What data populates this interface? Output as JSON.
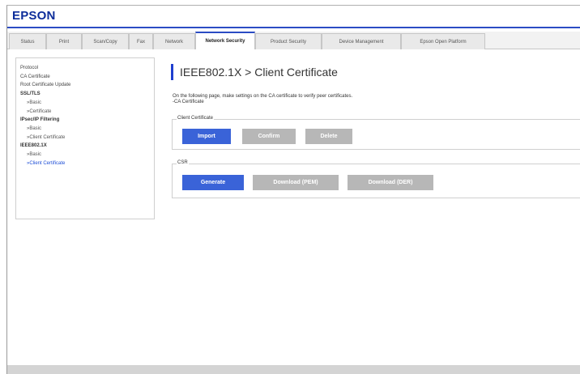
{
  "brand": {
    "logo_text": "EPSON",
    "accent_color": "#2b4cc4"
  },
  "tabs": [
    {
      "label": "Status",
      "active": false
    },
    {
      "label": "Print",
      "active": false
    },
    {
      "label": "Scan/Copy",
      "active": false
    },
    {
      "label": "Fax",
      "active": false
    },
    {
      "label": "Network",
      "active": false
    },
    {
      "label": "Network Security",
      "active": true
    },
    {
      "label": "Product Security",
      "active": false
    },
    {
      "label": "Device Management",
      "active": false
    },
    {
      "label": "Epson Open Platform",
      "active": false
    }
  ],
  "sidebar": {
    "items": [
      {
        "label": "Protocol"
      },
      {
        "label": "CA Certificate"
      },
      {
        "label": "Root Certificate Update"
      },
      {
        "label": "SSL/TLS"
      },
      {
        "label": "»Basic"
      },
      {
        "label": "»Certificate"
      },
      {
        "label": "IPsec/IP Filtering"
      },
      {
        "label": "»Basic"
      },
      {
        "label": "»Client Certificate"
      },
      {
        "label": "IEEE802.1X"
      },
      {
        "label": "»Basic"
      },
      {
        "label": "»Client Certificate",
        "selected": true
      }
    ]
  },
  "page": {
    "title": "IEEE802.1X > Client Certificate",
    "description_line1": "On the following page, make settings on the CA certificate to verify peer certificates.",
    "description_line2": "-CA Certificate"
  },
  "client_certificate": {
    "legend": "Client Certificate",
    "import_label": "Import",
    "confirm_label": "Confirm",
    "delete_label": "Delete"
  },
  "csr": {
    "legend": "CSR",
    "generate_label": "Generate",
    "download_pem_label": "Download (PEM)",
    "download_der_label": "Download (DER)"
  },
  "colors": {
    "primary_button": "#3a63d8",
    "disabled_button": "#b7b7b7",
    "title_bar": "#1f3fcf",
    "selected_link": "#1f4fd6"
  }
}
